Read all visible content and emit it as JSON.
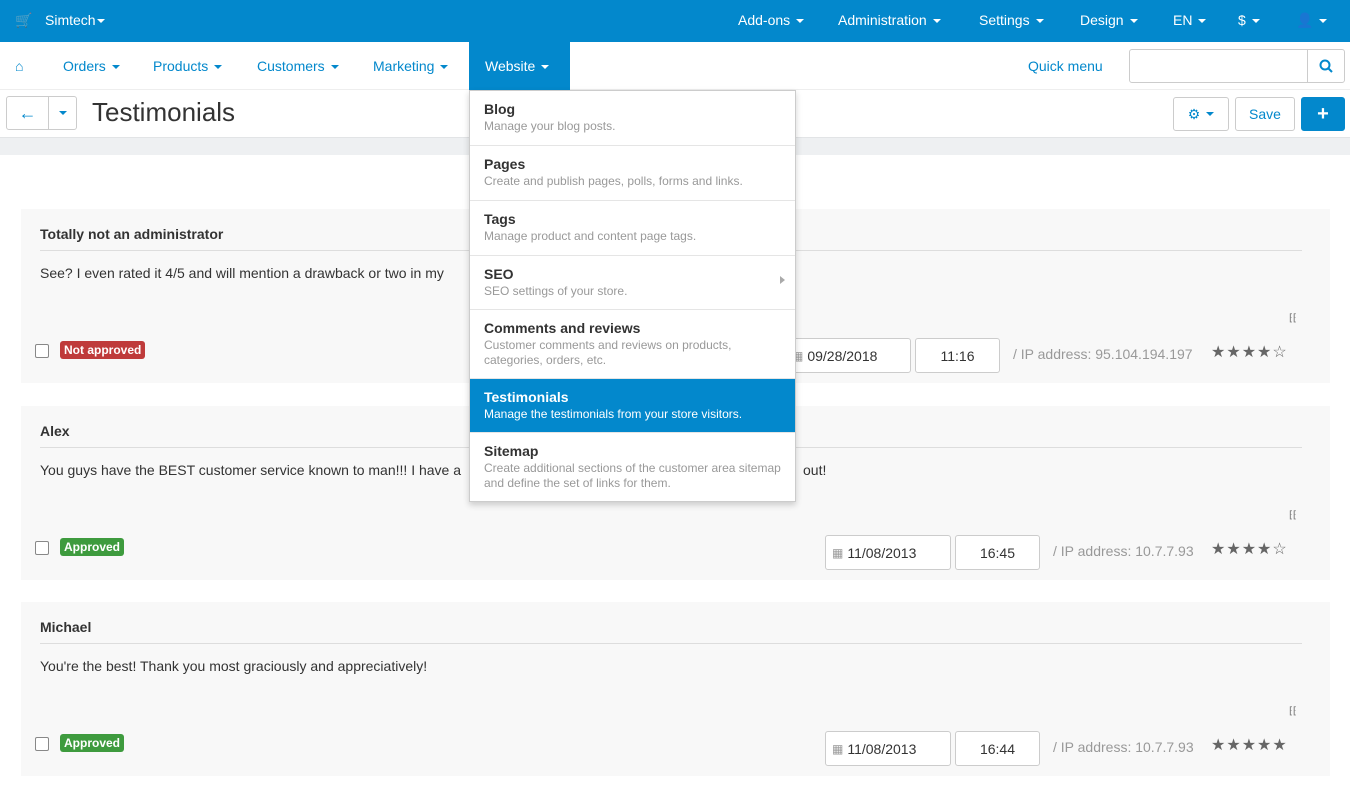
{
  "topbar": {
    "store": "Simtech",
    "addons": "Add-ons",
    "administration": "Administration",
    "settings": "Settings",
    "design": "Design",
    "language": "EN",
    "currency": "$"
  },
  "nav": {
    "items": [
      "Orders",
      "Products",
      "Customers",
      "Marketing"
    ],
    "active": "Website",
    "quick_menu": "Quick menu",
    "search_placeholder": ""
  },
  "toolbar": {
    "title": "Testimonials",
    "save": "Save"
  },
  "menu": [
    {
      "title": "Blog",
      "desc": "Manage your blog posts."
    },
    {
      "title": "Pages",
      "desc": "Create and publish pages, polls, forms and links."
    },
    {
      "title": "Tags",
      "desc": "Manage product and content page tags."
    },
    {
      "title": "SEO",
      "desc": "SEO settings of your store."
    },
    {
      "title": "Comments and reviews",
      "desc": "Customer comments and reviews on products, categories, orders, etc."
    },
    {
      "title": "Testimonials",
      "desc": "Manage the testimonials from your store visitors."
    },
    {
      "title": "Sitemap",
      "desc": "Create additional sections of the customer area sitemap and define the set of links for them."
    }
  ],
  "testimonials": [
    {
      "name": "Totally not an administrator",
      "text": "See? I even rated it 4/5 and will mention a drawback or two in my",
      "text_end": "",
      "status": "Not approved",
      "status_color": "#bf3b3b",
      "date": "09/28/2018",
      "time": "11:16",
      "ip": "/ IP address: 95.104.194.197",
      "rating": 4
    },
    {
      "name": "Alex",
      "text": "You guys have the BEST customer service known to man!!! I have a",
      "text_end": "out!",
      "status": "Approved",
      "status_color": "#3e9b3e",
      "date": "11/08/2013",
      "time": "16:45",
      "ip": "/ IP address: 10.7.7.93",
      "rating": 4
    },
    {
      "name": "Michael",
      "text": "You're the best! Thank you most graciously and appreciatively!",
      "text_end": "",
      "status": "Approved",
      "status_color": "#3e9b3e",
      "date": "11/08/2013",
      "time": "16:44",
      "ip": "/ IP address: 10.7.7.93",
      "rating": 5
    }
  ]
}
